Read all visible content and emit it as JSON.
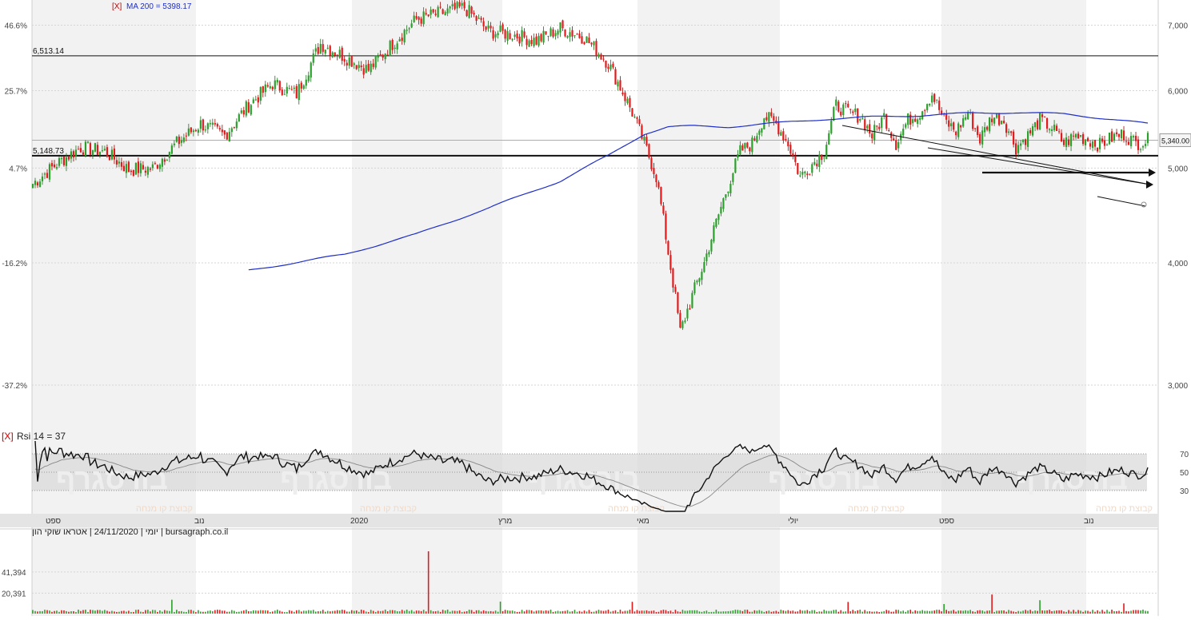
{
  "header": {
    "ma_toggle": "[X]",
    "ma_label": "MA 200 = 5398.17",
    "rsi_toggle": "[X]",
    "rsi_label": "Rsi 14 = 37",
    "footer_info": "יומי | 24/11/2020 | אטראו שוקי הון | bursagraph.co.il",
    "watermark": "בורסגרף",
    "watermark_sub": "קבוצת קו מנחה"
  },
  "colors": {
    "up": "#2ca02c",
    "down": "#e31a1c",
    "ma": "#1f2fc8",
    "price_line": "#d9a36a",
    "band": "#d9d9d9"
  },
  "chart_data": [
    {
      "type": "candlestick",
      "title": "",
      "ylim": [
        2700,
        7400
      ],
      "yticks_right": [
        "7,000",
        "6,000",
        "5,000",
        "4,000",
        "3,000"
      ],
      "yticks_left_pct": [
        "46.6%",
        "25.7%",
        "4.7%",
        "-16.2%",
        "-37.2%"
      ],
      "horizontal_levels": [
        {
          "label": "6,513.14",
          "value": 6513.14
        },
        {
          "label": "5,148.73",
          "value": 5148.73
        }
      ],
      "last_price_label": "5,340.00",
      "last_price": 5340,
      "ma200_label": "MA 200 = 5398.17",
      "x_month_labels": [
        "ספט",
        "נוב",
        "2020",
        "מרץ",
        "מאי",
        "יולי",
        "ספט",
        "נוב"
      ],
      "price_waypoints": [
        [
          0,
          4820
        ],
        [
          10,
          5050
        ],
        [
          20,
          5250
        ],
        [
          30,
          5200
        ],
        [
          40,
          4980
        ],
        [
          50,
          5000
        ],
        [
          60,
          5300
        ],
        [
          70,
          5550
        ],
        [
          80,
          5400
        ],
        [
          90,
          5800
        ],
        [
          100,
          6100
        ],
        [
          110,
          5950
        ],
        [
          120,
          6700
        ],
        [
          130,
          6500
        ],
        [
          140,
          6300
        ],
        [
          150,
          6700
        ],
        [
          160,
          7100
        ],
        [
          170,
          7200
        ],
        [
          180,
          7300
        ],
        [
          190,
          6900
        ],
        [
          200,
          6850
        ],
        [
          210,
          6750
        ],
        [
          220,
          6950
        ],
        [
          230,
          6800
        ],
        [
          240,
          6400
        ],
        [
          250,
          5700
        ],
        [
          255,
          5300
        ],
        [
          260,
          4900
        ],
        [
          265,
          4100
        ],
        [
          270,
          3400
        ],
        [
          275,
          3700
        ],
        [
          280,
          4000
        ],
        [
          285,
          4400
        ],
        [
          290,
          4800
        ],
        [
          295,
          5200
        ],
        [
          300,
          5300
        ],
        [
          305,
          5650
        ],
        [
          310,
          5550
        ],
        [
          315,
          5300
        ],
        [
          320,
          4900
        ],
        [
          325,
          5050
        ],
        [
          330,
          5200
        ],
        [
          335,
          5800
        ],
        [
          340,
          5700
        ],
        [
          345,
          5650
        ],
        [
          350,
          5400
        ],
        [
          355,
          5650
        ],
        [
          360,
          5300
        ],
        [
          365,
          5600
        ],
        [
          370,
          5700
        ],
        [
          375,
          5950
        ],
        [
          380,
          5600
        ],
        [
          385,
          5450
        ],
        [
          390,
          5700
        ],
        [
          395,
          5350
        ],
        [
          400,
          5650
        ],
        [
          405,
          5600
        ],
        [
          410,
          5250
        ],
        [
          415,
          5400
        ],
        [
          420,
          5600
        ],
        [
          425,
          5500
        ],
        [
          430,
          5300
        ],
        [
          435,
          5400
        ],
        [
          440,
          5350
        ],
        [
          445,
          5280
        ],
        [
          450,
          5370
        ],
        [
          455,
          5420
        ],
        [
          460,
          5300
        ],
        [
          465,
          5340
        ]
      ],
      "ma200_waypoints": [
        [
          90,
          3930
        ],
        [
          130,
          4080
        ],
        [
          160,
          4280
        ],
        [
          190,
          4550
        ],
        [
          220,
          4850
        ],
        [
          240,
          5150
        ],
        [
          255,
          5420
        ],
        [
          265,
          5510
        ],
        [
          275,
          5520
        ],
        [
          290,
          5510
        ],
        [
          310,
          5560
        ],
        [
          330,
          5610
        ],
        [
          350,
          5640
        ],
        [
          370,
          5660
        ],
        [
          390,
          5690
        ],
        [
          410,
          5700
        ],
        [
          430,
          5680
        ],
        [
          450,
          5610
        ],
        [
          465,
          5550
        ]
      ],
      "rsi": {
        "ylim": [
          0,
          100
        ],
        "yticks": [
          "70",
          "50",
          "30"
        ],
        "band": [
          30,
          70
        ],
        "last": 37
      },
      "volume": {
        "yticks": [
          "41,394",
          "20,391"
        ],
        "spike_value": 62000,
        "spike_index": 165
      }
    }
  ]
}
